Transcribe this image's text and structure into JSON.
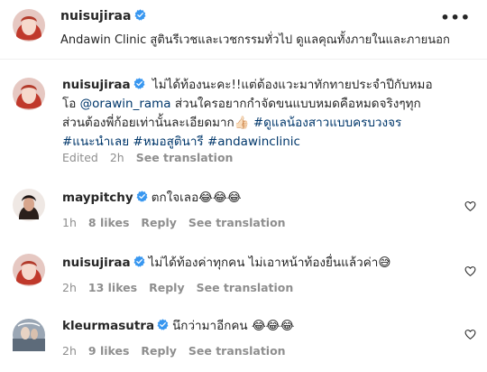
{
  "post": {
    "username": "nuisujiraa",
    "bio": "Andawin Clinic สูตินรีเวชและเวชกรรมทั่วไป ดูแลคุณทั้งภายในและภายนอก"
  },
  "caption": {
    "username": "nuisujiraa",
    "text_before_mention": " ไม่ได้ท้องนะคะ!!แต่ต้องแวะมาทักทายประจำปีกับหมอโอ ",
    "mention": "@orawin_rama",
    "text_after_mention": " ส่วนใครอยากกำจัดขนแบบหมดคือหมดจริงๆทุกส่วนต้องพี่ก้อยเท่านั้นละเอียดมาก👍🏻 ",
    "hashtags": "#ดูแลน้องสาวแบบครบวงจร #แนะนำเลย #หมอสูตินารี #andawinclinic",
    "edited": "Edited",
    "time": "2h",
    "see_translation": "See translation"
  },
  "comments": [
    {
      "username": "maypitchy",
      "text": "ตกใจเลอ😂😂😂",
      "time": "1h",
      "likes": "8 likes",
      "reply": "Reply",
      "see_translation": "See translation"
    },
    {
      "username": "nuisujiraa",
      "text": "ไม่ได้ท้องค่าทุกคน ไม่เอาหน้าท้องยื่นแล้วค่า😅",
      "time": "2h",
      "likes": "13 likes",
      "reply": "Reply",
      "see_translation": "See translation"
    },
    {
      "username": "kleurmasutra",
      "text": "นึกว่ามาอีกคน 😂😂😂",
      "time": "2h",
      "likes": "9 likes",
      "reply": "Reply",
      "see_translation": "See translation"
    }
  ],
  "colors": {
    "verified_badge": "#3897f0",
    "hashtag_link": "#00376b",
    "meta_gray": "#8e8e8e"
  },
  "icons": [
    "verified-badge-icon",
    "heart-icon",
    "more-options-icon"
  ]
}
